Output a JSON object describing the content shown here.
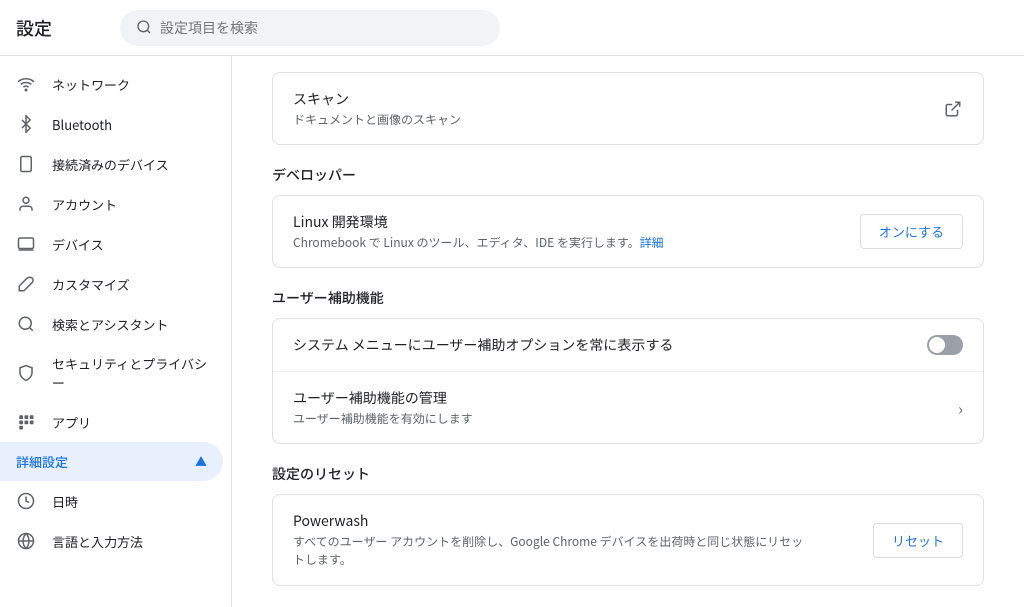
{
  "header": {
    "title": "設定",
    "search_placeholder": "設定項目を検索"
  },
  "sidebar": {
    "items": [
      {
        "id": "network",
        "label": "ネットワーク",
        "icon": "wifi"
      },
      {
        "id": "bluetooth",
        "label": "Bluetooth",
        "icon": "bluetooth"
      },
      {
        "id": "connected-devices",
        "label": "接続済みのデバイス",
        "icon": "smartphone"
      },
      {
        "id": "account",
        "label": "アカウント",
        "icon": "person"
      },
      {
        "id": "device",
        "label": "デバイス",
        "icon": "laptop"
      },
      {
        "id": "customize",
        "label": "カスタマイズ",
        "icon": "brush"
      },
      {
        "id": "search-assistant",
        "label": "検索とアシスタント",
        "icon": "search"
      },
      {
        "id": "security-privacy",
        "label": "セキュリティとプライバシー",
        "icon": "security"
      },
      {
        "id": "apps",
        "label": "アプリ",
        "icon": "apps"
      },
      {
        "id": "advanced",
        "label": "詳細設定",
        "icon": "",
        "active": true,
        "expanded": true
      },
      {
        "id": "datetime",
        "label": "日時",
        "icon": "clock"
      },
      {
        "id": "language",
        "label": "言語と入力方法",
        "icon": "language"
      }
    ]
  },
  "content": {
    "sections": [
      {
        "id": "scan-section",
        "rows": [
          {
            "id": "scan",
            "title": "スキャン",
            "subtitle": "ドキュメントと画像のスキャン",
            "action_type": "external-link"
          }
        ]
      },
      {
        "id": "developer-section",
        "heading": "デベロッパー",
        "rows": [
          {
            "id": "linux-dev",
            "title": "Linux 開発環境",
            "subtitle_before_link": "Chromebook で Linux のツール、エディタ、IDE を実行します。",
            "subtitle_link": "詳細",
            "action_type": "button",
            "button_label": "オンにする"
          }
        ]
      },
      {
        "id": "accessibility-section",
        "heading": "ユーザー補助機能",
        "rows": [
          {
            "id": "always-show-a11y",
            "title": "システム メニューにユーザー補助オプションを常に表示する",
            "action_type": "toggle",
            "toggle_on": false
          },
          {
            "id": "manage-a11y",
            "title": "ユーザー補助機能の管理",
            "subtitle": "ユーザー補助機能を有効にします",
            "action_type": "chevron"
          }
        ]
      },
      {
        "id": "reset-section",
        "heading": "設定のリセット",
        "rows": [
          {
            "id": "powerwash",
            "title": "Powerwash",
            "subtitle": "すべてのユーザー アカウントを削除し、Google Chrome デバイスを出荷時と同じ状態にリセットします。",
            "action_type": "button",
            "button_label": "リセット"
          }
        ]
      }
    ]
  }
}
